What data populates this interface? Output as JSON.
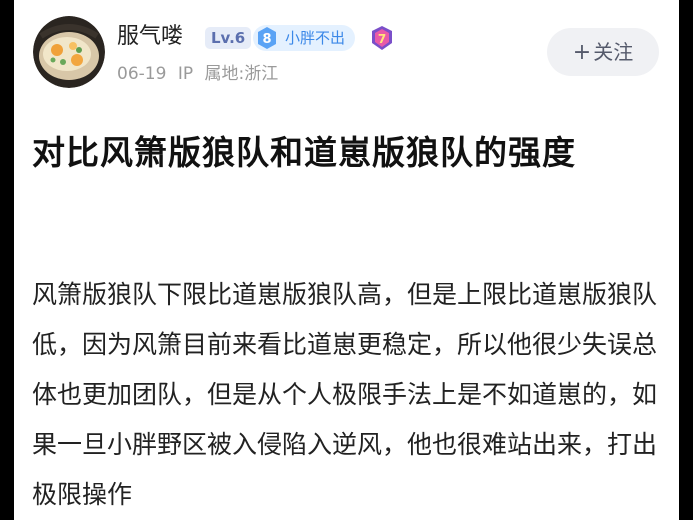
{
  "author": {
    "name": "服气喽",
    "level": "Lv.6",
    "fan_badge": {
      "level": "8",
      "label": "小胖不出"
    },
    "rank_badge": "7",
    "date": "06-19",
    "ip_location": "IP 属地:浙江"
  },
  "follow_button": {
    "plus": "+",
    "label": "关注"
  },
  "post": {
    "title": "对比风箫版狼队和道崽版狼队的强度",
    "body": "风箫版狼队下限比道崽版狼队高，但是上限比道崽版狼队低，因为风箫目前来看比道崽更稳定，所以他很少失误总体也更加团队，但是从个人极限手法上是不如道崽的，如果一旦小胖野区被入侵陷入逆风，他也很难站出来，打出极限操作"
  },
  "colors": {
    "background": "#ffffff",
    "fan_badge_text": "#3b88e8",
    "level_badge_text": "#5b6fae",
    "rank_badge": "#7a4fc9",
    "meta_text": "#9a9a9a"
  }
}
